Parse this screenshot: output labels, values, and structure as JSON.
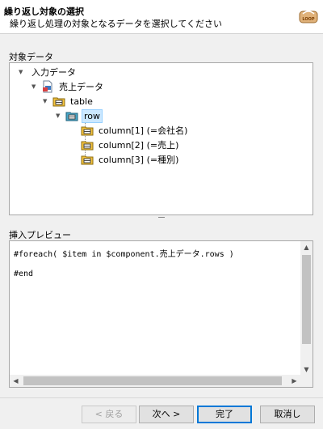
{
  "header": {
    "title": "繰り返し対象の選択",
    "description": "繰り返し処理の対象となるデータを選択してください",
    "logo_text": "LOOP"
  },
  "tree_section": {
    "label": "対象データ",
    "nodes": [
      {
        "label": "入力データ",
        "icon": "none",
        "expanded": true
      },
      {
        "label": "売上データ",
        "icon": "data-file-icon",
        "expanded": true
      },
      {
        "label": "table",
        "icon": "folder-icon",
        "expanded": true
      },
      {
        "label": "row",
        "icon": "folder-icon",
        "expanded": true,
        "selected": true
      },
      {
        "label": "column[1] (=会社名)",
        "icon": "folder-icon"
      },
      {
        "label": "column[2] (=売上)",
        "icon": "folder-icon"
      },
      {
        "label": "column[3] (=種別)",
        "icon": "folder-icon"
      }
    ]
  },
  "preview_section": {
    "label": "挿入プレビュー",
    "lines": [
      "#foreach( $item in $component.売上データ.rows )",
      "",
      "#end"
    ]
  },
  "buttons": {
    "back": "< 戻る",
    "next": "次へ >",
    "finish": "完了",
    "cancel": "取消し"
  },
  "colors": {
    "selection_bg": "#cce8ff",
    "default_button_border": "#0078d7",
    "folder_yellow": "#f5c33b"
  }
}
